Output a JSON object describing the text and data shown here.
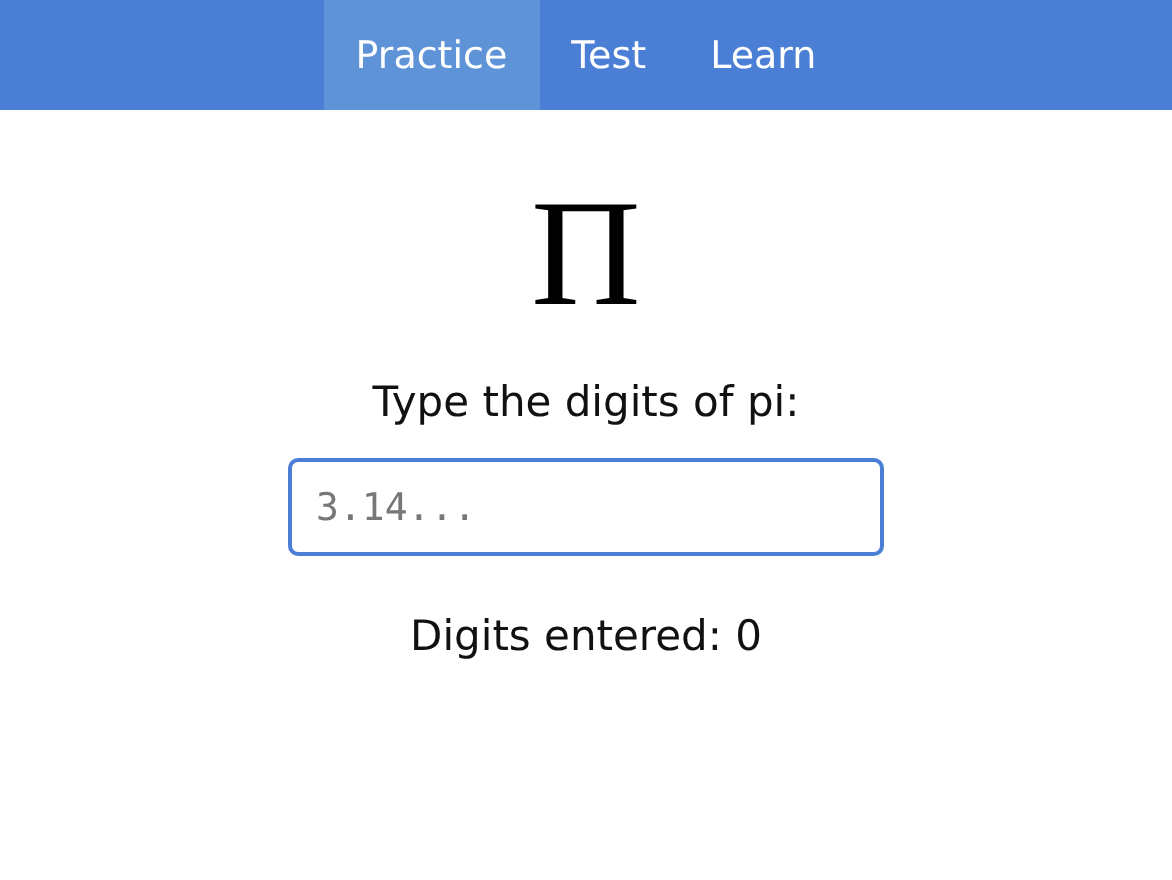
{
  "nav": {
    "tabs": [
      {
        "label": "Practice",
        "selected": true
      },
      {
        "label": "Test",
        "selected": false
      },
      {
        "label": "Learn",
        "selected": false
      }
    ]
  },
  "symbol": "Π",
  "prompt": "Type the digits of pi:",
  "input": {
    "placeholder": "3.14..."
  },
  "counter": "Digits entered: 0"
}
